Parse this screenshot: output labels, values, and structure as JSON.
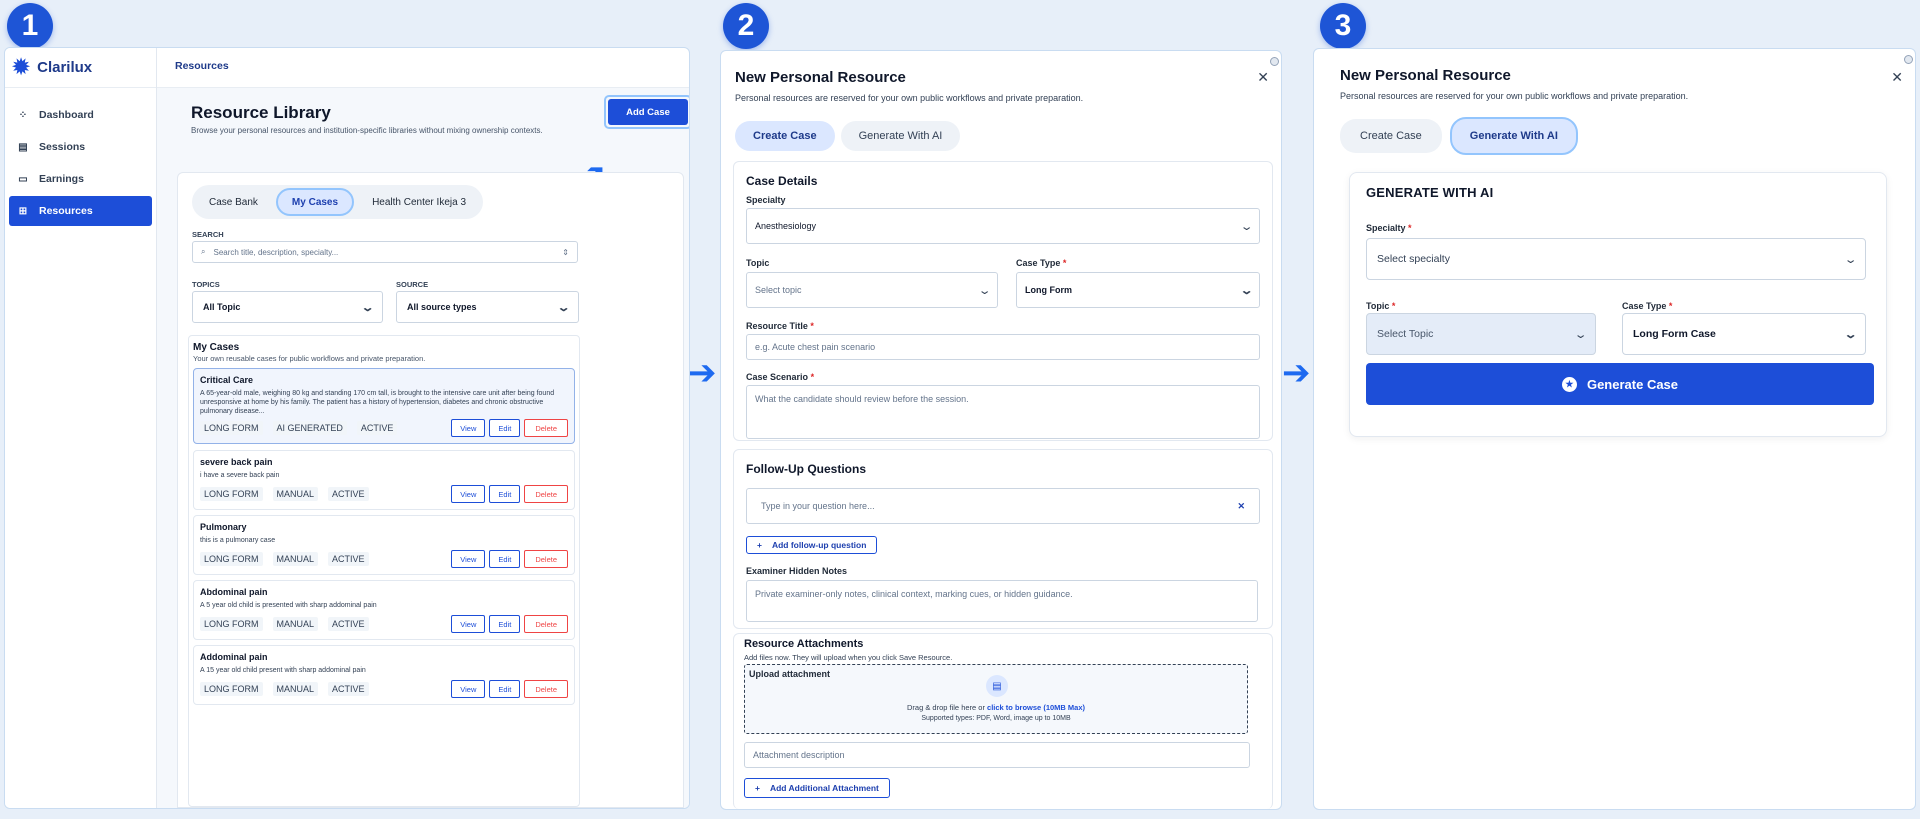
{
  "steps": [
    "1",
    "2",
    "3"
  ],
  "panel1": {
    "brand": "Clarilux",
    "breadcrumb": "Resources",
    "nav": [
      {
        "label": "Dashboard",
        "icon": "grid-icon"
      },
      {
        "label": "Sessions",
        "icon": "calendar-icon"
      },
      {
        "label": "Earnings",
        "icon": "wallet-icon"
      },
      {
        "label": "Resources",
        "icon": "book-icon",
        "active": true
      }
    ],
    "title": "Resource Library",
    "subtitle": "Browse your personal resources and institution-specific libraries without mixing ownership contexts.",
    "add_case": "Add Case",
    "tabs": [
      "Case Bank",
      "My Cases",
      "Health Center Ikeja 3"
    ],
    "search_label": "SEARCH",
    "search_placeholder": "Search title, description, specialty...",
    "topics_label": "TOPICS",
    "topics_value": "All Topic",
    "source_label": "SOURCE",
    "source_value": "All source types",
    "list_title": "My Cases",
    "list_subtitle": "Your own reusable cases for public workflows and private preparation.",
    "actions": {
      "view": "View",
      "edit": "Edit",
      "delete": "Delete"
    },
    "cases": [
      {
        "title": "Critical Care",
        "desc": "A 65-year-old male, weighing 80 kg and standing 170 cm tall, is brought to the intensive care unit after being found unresponsive at home by his family. The patient has a history of hypertension, diabetes and chronic obstructive pulmonary disease...",
        "tags": [
          "LONG FORM",
          "AI GENERATED",
          "ACTIVE"
        ]
      },
      {
        "title": "severe back pain",
        "desc": "i have a severe back pain",
        "tags": [
          "LONG FORM",
          "MANUAL",
          "ACTIVE"
        ]
      },
      {
        "title": "Pulmonary",
        "desc": "this is a pulmonary case",
        "tags": [
          "LONG FORM",
          "MANUAL",
          "ACTIVE"
        ]
      },
      {
        "title": "Abdominal pain",
        "desc": "A 5 year old child is presented with sharp addominal pain",
        "tags": [
          "LONG FORM",
          "MANUAL",
          "ACTIVE"
        ]
      },
      {
        "title": "Addominal pain",
        "desc": "A 15 year old child present with sharp addominal pain",
        "tags": [
          "LONG FORM",
          "MANUAL",
          "ACTIVE"
        ]
      }
    ]
  },
  "panel2": {
    "title": "New Personal Resource",
    "subtitle": "Personal resources are reserved for your own public workflows and private preparation.",
    "tabs": [
      "Create Case",
      "Generate With AI"
    ],
    "details_title": "Case Details",
    "specialty_label": "Specialty",
    "specialty_value": "Anesthesiology",
    "topic_label": "Topic",
    "topic_placeholder": "Select topic",
    "case_type_label": "Case Type",
    "case_type_value": "Long Form",
    "resource_title_label": "Resource Title",
    "resource_title_placeholder": "e.g. Acute chest pain scenario",
    "scenario_label": "Case Scenario",
    "scenario_placeholder": "What the candidate should review before the session.",
    "followup_title": "Follow-Up Questions",
    "question_placeholder": "Type in your question here...",
    "add_followup": "Add follow-up question",
    "notes_label": "Examiner Hidden Notes",
    "notes_placeholder": "Private examiner-only notes, clinical context, marking cues, or hidden guidance.",
    "attach_title": "Resource Attachments",
    "attach_sub": "Add files now. They will upload when you click Save Resource.",
    "upload_label": "Upload attachment",
    "drop_text": "Drag & drop file here or ",
    "browse_link": "click to browse (10MB Max)",
    "supported": "Supported types: PDF, Word, image up to 10MB",
    "attach_desc_placeholder": "Attachment description",
    "add_attachment": "Add Additional Attachment"
  },
  "panel3": {
    "title": "New Personal Resource",
    "subtitle": "Personal resources are reserved for your own public workflows and private preparation.",
    "tabs": [
      "Create Case",
      "Generate With AI"
    ],
    "gen_title": "GENERATE WITH AI",
    "specialty_label": "Specialty",
    "specialty_placeholder": "Select specialty",
    "topic_label": "Topic",
    "topic_placeholder": "Select Topic",
    "case_type_label": "Case Type",
    "case_type_value": "Long Form Case",
    "generate": "Generate Case"
  }
}
